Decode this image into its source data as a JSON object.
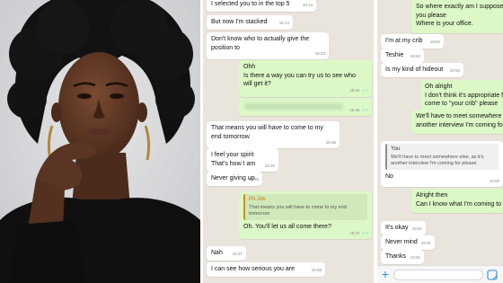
{
  "chat_left": {
    "messages": [
      {
        "text": "I selected you to in the top 5",
        "time": "18:14"
      },
      {
        "text": "But now I'm stacked",
        "time": "18:14"
      },
      {
        "text": "Don't know who to actually give the",
        "text2": "position to",
        "time": "18:33"
      },
      {
        "text": "Ohh",
        "text2": "Is there a way you can try us to see who",
        "text3": "will get it?",
        "time": "18:34"
      },
      {
        "text": "",
        "time": "18:35"
      },
      {
        "text": "That means you will have to come to my",
        "text2": "end tomorrow",
        "time": "18:36"
      },
      {
        "text": "I feel your spirit",
        "text2": "That's how I am",
        "time": "18:36"
      },
      {
        "text": "Never giving up",
        "time": "18:36"
      },
      {
        "quote_sender": "PA Job",
        "quote_text": "That means you will have to come to my end tomorrow",
        "text": "Oh. You'll let us all come there?",
        "time": "18:37"
      },
      {
        "text": "Nah",
        "time": "18:37"
      },
      {
        "text": "I can see how serious you are",
        "time": "18:38"
      }
    ]
  },
  "chat_right": {
    "messages": [
      {
        "text": "So where exactly am I suppose",
        "text2": "you please",
        "text3": "Where is your office."
      },
      {
        "text": "I'm at my crib",
        "time": "18:52"
      },
      {
        "text": "Teshie",
        "time": "18:52"
      },
      {
        "text": "Is my kind of hideout",
        "time": "18:52"
      },
      {
        "text": "Oh alright",
        "text2": "I don't think it's appropriate f",
        "text3": "come to \"your crib\" please"
      },
      {
        "text": "We'll have to meet somewhere e",
        "text2": "another interview I'm coming for"
      },
      {
        "quote_sender": "You",
        "quote_text": "We'll have to meet somewhere else, as it's another interview I'm coming for please",
        "text": "No",
        "time": "18:56"
      },
      {
        "text": "Alright then",
        "text2": "Can I know what I'm coming to"
      },
      {
        "text": "It's okay",
        "time": "19:01"
      },
      {
        "text": "Never mind",
        "time": "19:01"
      },
      {
        "text": "Thanks",
        "time": "19:01"
      }
    ]
  },
  "input_bar": {
    "placeholder": ""
  },
  "colors": {
    "chat_bg": "#e9e4dc",
    "incoming": "#ffffff",
    "outgoing": "#dcf8c6",
    "read_ticks": "#4fb6ec",
    "quote_bar": "#d88a1f"
  },
  "icons": {
    "add": "plus-icon",
    "sticker": "sticker-icon",
    "read": "double-check-icon"
  }
}
